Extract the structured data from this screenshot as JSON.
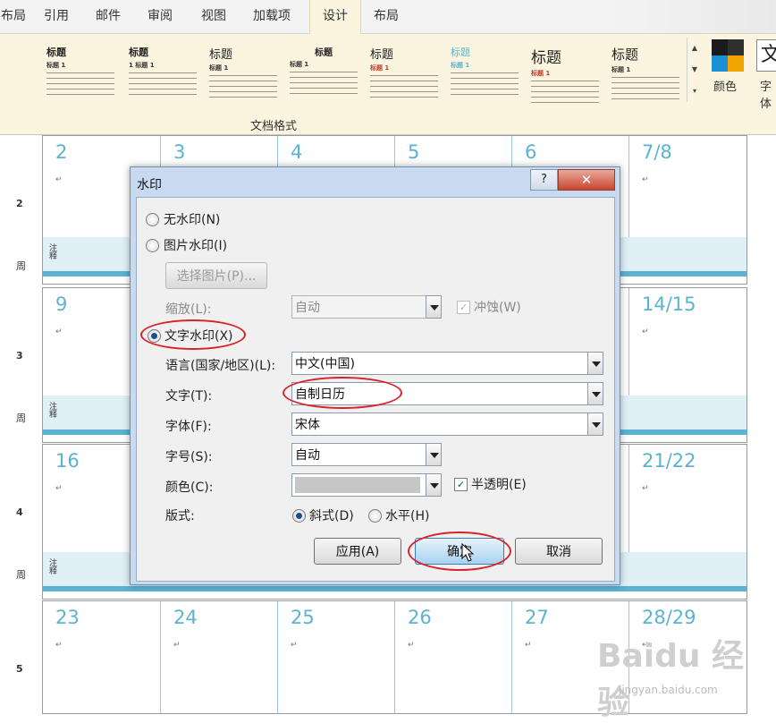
{
  "ribbon": {
    "tabs": [
      {
        "label": "布局",
        "active": false
      },
      {
        "label": "引用",
        "active": false
      },
      {
        "label": "邮件",
        "active": false
      },
      {
        "label": "审阅",
        "active": false
      },
      {
        "label": "视图",
        "active": false
      },
      {
        "label": "加载项",
        "active": false
      },
      {
        "label": "设计",
        "active": true
      },
      {
        "label": "布局",
        "active": false
      }
    ],
    "styles": [
      {
        "title": "标题",
        "sub": "标题 1"
      },
      {
        "title": "标题",
        "sub": "1 标题 1"
      },
      {
        "title": "标题",
        "sub": "标题 1"
      },
      {
        "title": "标题",
        "sub": "标题 1"
      },
      {
        "title": "标题",
        "sub": "标题 1"
      },
      {
        "title": "标题",
        "sub": "标题 1"
      },
      {
        "title": "标题",
        "sub": "标题 1"
      },
      {
        "title": "标题",
        "sub": "标题 1"
      }
    ],
    "group_label": "文档格式",
    "colors_label": "颜色",
    "fonts_label": "字体",
    "fonts_glyph": "文",
    "swatch_colors": [
      "#1b1b1b",
      "#1a8fd6",
      "#f0a400",
      "#2f2f2f"
    ]
  },
  "calendar": {
    "weeks": [
      {
        "week_no": "2",
        "side": "周",
        "days": [
          "2",
          "3",
          "4",
          "5",
          "6",
          "7/8"
        ]
      },
      {
        "week_no": "3",
        "side": "周",
        "days": [
          "9",
          "",
          "",
          "",
          "",
          "14/15"
        ]
      },
      {
        "week_no": "4",
        "side": "周",
        "days": [
          "16",
          "",
          "",
          "",
          "",
          "21/22"
        ]
      },
      {
        "week_no": "5",
        "side": "周",
        "days": [
          "23",
          "24",
          "25",
          "26",
          "27",
          "28/29"
        ]
      }
    ],
    "note_label": "注释",
    "para_mark": "↵",
    "accent": "#5bb3d1"
  },
  "dialog": {
    "title": "水印",
    "help": "?",
    "close": "✕",
    "no_watermark": "无水印(N)",
    "picture_watermark": "图片水印(I)",
    "select_picture": "选择图片(P)...",
    "scale_label": "缩放(L):",
    "scale_value": "自动",
    "washout_label": "冲蚀(W)",
    "text_watermark": "文字水印(X)",
    "language_label": "语言(国家/地区)(L):",
    "language_value": "中文(中国)",
    "text_label": "文字(T):",
    "text_value": "自制日历",
    "font_label": "字体(F):",
    "font_value": "宋体",
    "size_label": "字号(S):",
    "size_value": "自动",
    "color_label": "颜色(C):",
    "semitransparent_label": "半透明(E)",
    "layout_label": "版式:",
    "diagonal_label": "斜式(D)",
    "horizontal_label": "水平(H)",
    "apply_label": "应用(A)",
    "ok_label": "确定",
    "cancel_label": "取消",
    "selected_mode": "text",
    "semitransparent_checked": true,
    "washout_checked": true,
    "layout_selected": "diagonal"
  },
  "watermark_overlay": {
    "brand": "Baidu 经验",
    "url": "jingyan.baidu.com"
  }
}
